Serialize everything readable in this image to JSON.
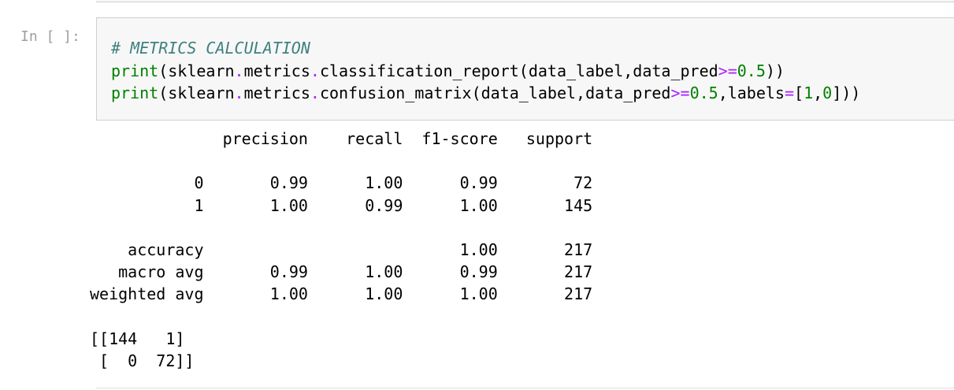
{
  "previous_cell": {},
  "cell": {
    "prompt": "In [ ]:",
    "code_lines": [
      [
        {
          "cls": "cm-comment",
          "text": "# METRICS CALCULATION"
        }
      ],
      [
        {
          "cls": "cm-builtin",
          "text": "print"
        },
        {
          "cls": "cm-plain",
          "text": "(sklearn"
        },
        {
          "cls": "cm-op",
          "text": "."
        },
        {
          "cls": "cm-plain",
          "text": "metrics"
        },
        {
          "cls": "cm-op",
          "text": "."
        },
        {
          "cls": "cm-plain",
          "text": "classification_report(data_label,data_pred"
        },
        {
          "cls": "cm-op",
          "text": ">="
        },
        {
          "cls": "cm-num",
          "text": "0.5"
        },
        {
          "cls": "cm-plain",
          "text": "))"
        }
      ],
      [
        {
          "cls": "cm-builtin",
          "text": "print"
        },
        {
          "cls": "cm-plain",
          "text": "(sklearn"
        },
        {
          "cls": "cm-op",
          "text": "."
        },
        {
          "cls": "cm-plain",
          "text": "metrics"
        },
        {
          "cls": "cm-op",
          "text": "."
        },
        {
          "cls": "cm-plain",
          "text": "confusion_matrix(data_label,data_pred"
        },
        {
          "cls": "cm-op",
          "text": ">="
        },
        {
          "cls": "cm-num",
          "text": "0.5"
        },
        {
          "cls": "cm-plain",
          "text": ",labels"
        },
        {
          "cls": "cm-op",
          "text": "="
        },
        {
          "cls": "cm-plain",
          "text": "["
        },
        {
          "cls": "cm-num",
          "text": "1"
        },
        {
          "cls": "cm-plain",
          "text": ","
        },
        {
          "cls": "cm-num",
          "text": "0"
        },
        {
          "cls": "cm-plain",
          "text": "]))"
        }
      ]
    ],
    "output_lines": [
      "              precision    recall  f1-score   support",
      "",
      "           0       0.99      1.00      0.99        72",
      "           1       1.00      0.99      1.00       145",
      "",
      "    accuracy                           1.00       217",
      "   macro avg       0.99      1.00      0.99       217",
      "weighted avg       1.00      1.00      1.00       217",
      "",
      "[[144   1]",
      " [  0  72]]"
    ]
  }
}
